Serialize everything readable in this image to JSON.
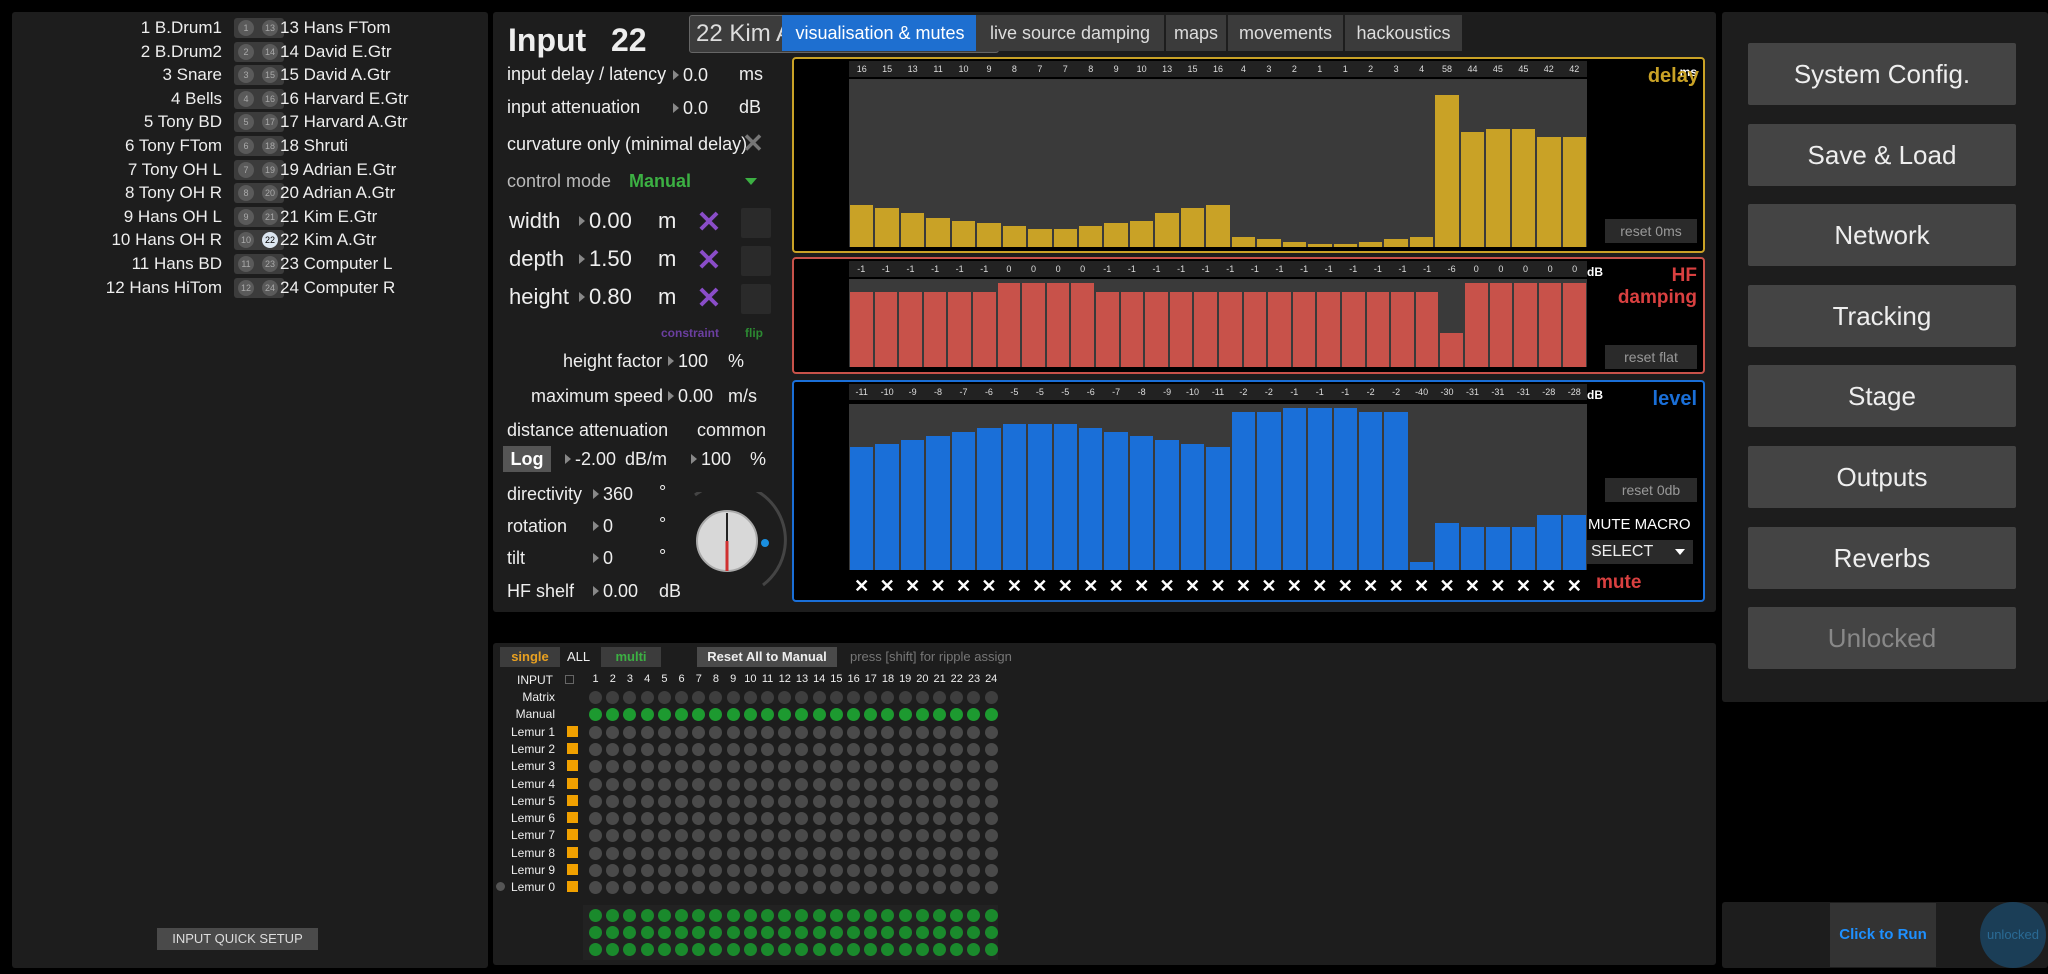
{
  "inputs_left": [
    "1 B.Drum1",
    "2 B.Drum2",
    "3 Snare",
    "4 Bells",
    "5 Tony BD",
    "6 Tony FTom",
    "7 Tony OH L",
    "8 Tony OH R",
    "9 Hans OH L",
    "10 Hans OH R",
    "11 Hans BD",
    "12 Hans HiTom"
  ],
  "inputs_right": [
    "13 Hans FTom",
    "14 David E.Gtr",
    "15 David A.Gtr",
    "16 Harvard E.Gtr",
    "17 Harvard A.Gtr",
    "18 Shruti",
    "19 Adrian E.Gtr",
    "20 Adrian A.Gtr",
    "21 Kim E.Gtr",
    "22 Kim A.Gtr",
    "23 Computer L",
    "24 Computer R"
  ],
  "bubbles_left": [
    "1",
    "2",
    "3",
    "4",
    "5",
    "6",
    "7",
    "8",
    "9",
    "10",
    "11",
    "12"
  ],
  "bubbles_right": [
    "13",
    "14",
    "15",
    "16",
    "17",
    "18",
    "19",
    "20",
    "21",
    "22",
    "23",
    "24"
  ],
  "selected_input": "22",
  "quick_setup_label": "INPUT QUICK SETUP",
  "header": {
    "input_label": "Input",
    "input_number": "22",
    "name_value": "22 Kim A.Gtr"
  },
  "tabs": [
    "visualisation & mutes",
    "live source damping",
    "maps",
    "movements",
    "hackoustics"
  ],
  "params": {
    "input_delay_label": "input delay / latency",
    "input_delay_value": "0.0",
    "input_delay_unit": "ms",
    "input_att_label": "input attenuation",
    "input_att_value": "0.0",
    "input_att_unit": "dB",
    "curvature_label": "curvature only (minimal delay)",
    "control_mode_label": "control mode",
    "control_mode_value": "Manual",
    "width_label": "width",
    "width_value": "0.00",
    "depth_label": "depth",
    "depth_value": "1.50",
    "height_label": "height",
    "height_value": "0.80",
    "m_unit": "m",
    "constraint_label": "constraint",
    "flip_label": "flip",
    "height_factor_label": "height factor",
    "height_factor_value": "100",
    "pct": "%",
    "max_speed_label": "maximum speed",
    "max_speed_value": "0.00",
    "max_speed_unit": "m/s",
    "dist_att_label": "distance attenuation",
    "common_label": "common",
    "log_label": "Log",
    "dist_att_value": "-2.00",
    "dist_att_unit": "dB/m",
    "common_value": "100",
    "directivity_label": "directivity",
    "directivity_value": "360",
    "rotation_label": "rotation",
    "rotation_value": "0",
    "tilt_label": "tilt",
    "tilt_value": "0",
    "deg": "°",
    "hf_shelf_label": "HF shelf",
    "hf_shelf_value": "0.00",
    "hf_shelf_unit": "dB"
  },
  "delay_viz": {
    "unit": "ms",
    "title": "delay",
    "reset_label": "reset 0ms",
    "color": "#c9a226",
    "labels": [
      "16",
      "15",
      "13",
      "11",
      "10",
      "9",
      "8",
      "7",
      "7",
      "8",
      "9",
      "10",
      "13",
      "15",
      "16",
      "4",
      "3",
      "2",
      "1",
      "1",
      "2",
      "3",
      "4",
      "58",
      "44",
      "45",
      "45",
      "42",
      "42"
    ],
    "values": [
      16,
      15,
      13,
      11,
      10,
      9,
      8,
      7,
      7,
      8,
      9,
      10,
      13,
      15,
      16,
      4,
      3,
      2,
      1,
      1,
      2,
      3,
      4,
      58,
      44,
      45,
      45,
      42,
      42
    ]
  },
  "hf_viz": {
    "unit": "dB",
    "title_line1": "HF",
    "title_line2": "damping",
    "reset_label": "reset flat",
    "color": "#c8524a",
    "labels": [
      "-1",
      "-1",
      "-1",
      "-1",
      "-1",
      "-1",
      "0",
      "0",
      "0",
      "0",
      "-1",
      "-1",
      "-1",
      "-1",
      "-1",
      "-1",
      "-1",
      "-1",
      "-1",
      "-1",
      "-1",
      "-1",
      "-1",
      "-1",
      "-6",
      "0",
      "0",
      "0",
      "0",
      "0"
    ],
    "values": [
      -1,
      -1,
      -1,
      -1,
      -1,
      -1,
      0,
      0,
      0,
      0,
      -1,
      -1,
      -1,
      -1,
      -1,
      -1,
      -1,
      -1,
      -1,
      -1,
      -1,
      -1,
      -1,
      -1,
      -6,
      0,
      0,
      0,
      0,
      0
    ]
  },
  "level_viz": {
    "unit": "dB",
    "title": "level",
    "reset_label": "reset 0db",
    "color": "#1a6fd8",
    "labels": [
      "-11",
      "-10",
      "-9",
      "-8",
      "-7",
      "-6",
      "-5",
      "-5",
      "-5",
      "-6",
      "-7",
      "-8",
      "-9",
      "-10",
      "-11",
      "-2",
      "-2",
      "-1",
      "-1",
      "-1",
      "-2",
      "-2",
      "-40",
      "-30",
      "-31",
      "-31",
      "-31",
      "-28",
      "-28"
    ],
    "values": [
      -11,
      -10,
      -9,
      -8,
      -7,
      -6,
      -5,
      -5,
      -5,
      -6,
      -7,
      -8,
      -9,
      -10,
      -11,
      -2,
      -2,
      -1,
      -1,
      -1,
      -2,
      -2,
      -40,
      -30,
      -31,
      -31,
      -31,
      -28,
      -28
    ],
    "mute_macro_label": "MUTE MACRO",
    "select_label": "SELECT",
    "mute_label": "mute"
  },
  "matrix": {
    "single_label": "single",
    "all_label": "ALL",
    "multi_label": "multi",
    "reset_all_label": "Reset All to Manual",
    "hint": "press [shift] for ripple assign",
    "input_label": "INPUT",
    "columns": [
      "1",
      "2",
      "3",
      "4",
      "5",
      "6",
      "7",
      "8",
      "9",
      "10",
      "11",
      "12",
      "13",
      "14",
      "15",
      "16",
      "17",
      "18",
      "19",
      "20",
      "21",
      "22",
      "23",
      "24"
    ],
    "rows": [
      "Matrix",
      "Manual",
      "Lemur 1",
      "Lemur 2",
      "Lemur 3",
      "Lemur 4",
      "Lemur 5",
      "Lemur 6",
      "Lemur 7",
      "Lemur 8",
      "Lemur 9",
      "Lemur 0"
    ]
  },
  "right_menu": [
    "System Config.",
    "Save & Load",
    "Network",
    "Tracking",
    "Stage",
    "Outputs",
    "Reverbs",
    "Unlocked"
  ],
  "run_label": "Click to Run",
  "unlocked_label": "unlocked"
}
